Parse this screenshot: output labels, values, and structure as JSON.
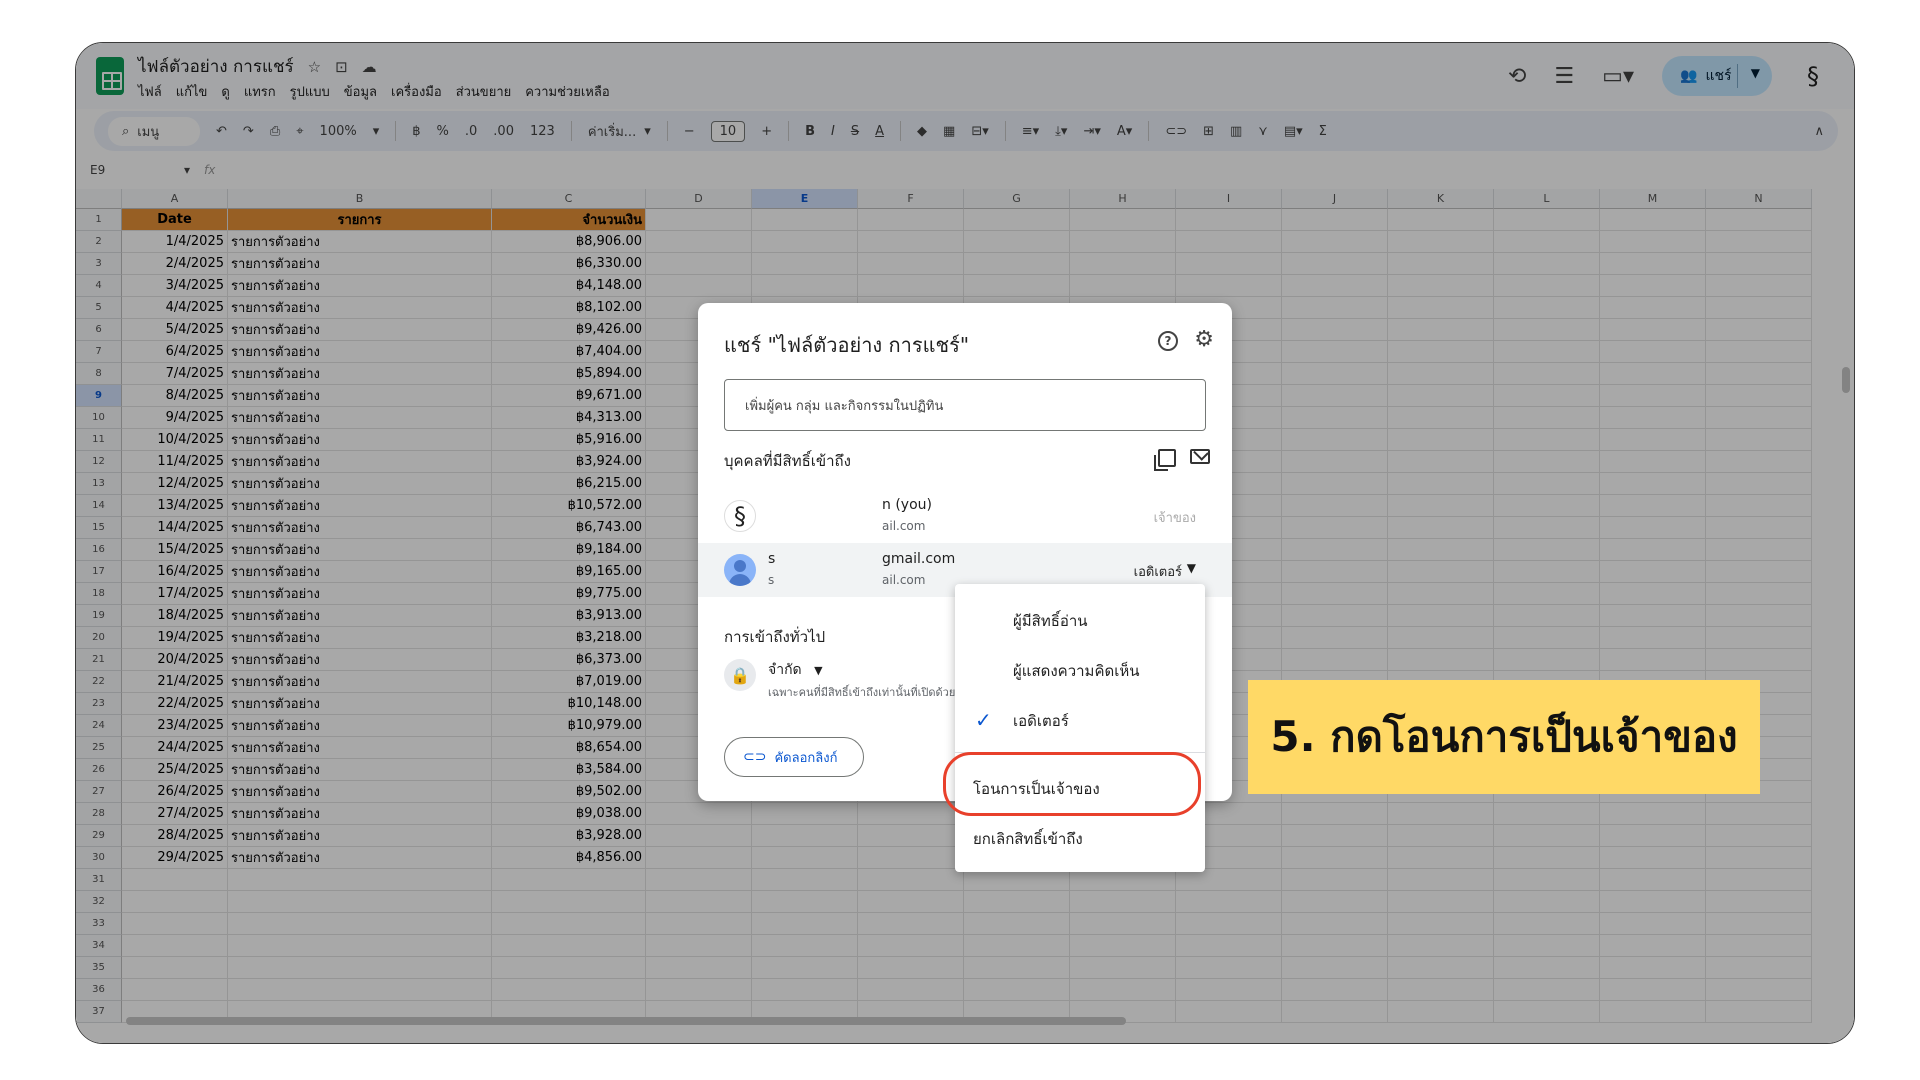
{
  "doc": {
    "title": "ไฟล์ตัวอย่าง การแชร์",
    "menus": [
      "ไฟล์",
      "แก้ไข",
      "ดู",
      "แทรก",
      "รูปแบบ",
      "ข้อมูล",
      "เครื่องมือ",
      "ส่วนขยาย",
      "ความช่วยเหลือ"
    ]
  },
  "topbar": {
    "share_label": "แชร์",
    "icons": [
      "history-icon",
      "comment-icon",
      "meet-icon",
      "share-people-icon",
      "account-avatar"
    ]
  },
  "toolbar": {
    "search_label": "เมนู",
    "zoom": "100%",
    "currency": "฿",
    "percent": "%",
    "dec_dec": ".0",
    "dec_inc": ".00",
    "number_format": "123",
    "font": "ค่าเริ่ม...",
    "font_size": "10",
    "minus": "−",
    "plus": "+",
    "bold": "B",
    "italic": "I",
    "sum": "Σ"
  },
  "formula_bar": {
    "cell_ref": "E9",
    "fx": "fx"
  },
  "grid": {
    "columns": [
      "A",
      "B",
      "C",
      "D",
      "E",
      "F",
      "G",
      "H",
      "I",
      "J",
      "K",
      "L",
      "M",
      "N"
    ],
    "selected_column": "E",
    "selected_row": "9",
    "header_row": [
      "Date",
      "รายการ",
      "จำนวนเงิน"
    ],
    "rows": [
      [
        "1/4/2025",
        "รายการตัวอย่าง",
        "฿8,906.00"
      ],
      [
        "2/4/2025",
        "รายการตัวอย่าง",
        "฿6,330.00"
      ],
      [
        "3/4/2025",
        "รายการตัวอย่าง",
        "฿4,148.00"
      ],
      [
        "4/4/2025",
        "รายการตัวอย่าง",
        "฿8,102.00"
      ],
      [
        "5/4/2025",
        "รายการตัวอย่าง",
        "฿9,426.00"
      ],
      [
        "6/4/2025",
        "รายการตัวอย่าง",
        "฿7,404.00"
      ],
      [
        "7/4/2025",
        "รายการตัวอย่าง",
        "฿5,894.00"
      ],
      [
        "8/4/2025",
        "รายการตัวอย่าง",
        "฿9,671.00"
      ],
      [
        "9/4/2025",
        "รายการตัวอย่าง",
        "฿4,313.00"
      ],
      [
        "10/4/2025",
        "รายการตัวอย่าง",
        "฿5,916.00"
      ],
      [
        "11/4/2025",
        "รายการตัวอย่าง",
        "฿3,924.00"
      ],
      [
        "12/4/2025",
        "รายการตัวอย่าง",
        "฿6,215.00"
      ],
      [
        "13/4/2025",
        "รายการตัวอย่าง",
        "฿10,572.00"
      ],
      [
        "14/4/2025",
        "รายการตัวอย่าง",
        "฿6,743.00"
      ],
      [
        "15/4/2025",
        "รายการตัวอย่าง",
        "฿9,184.00"
      ],
      [
        "16/4/2025",
        "รายการตัวอย่าง",
        "฿9,165.00"
      ],
      [
        "17/4/2025",
        "รายการตัวอย่าง",
        "฿9,775.00"
      ],
      [
        "18/4/2025",
        "รายการตัวอย่าง",
        "฿3,913.00"
      ],
      [
        "19/4/2025",
        "รายการตัวอย่าง",
        "฿3,218.00"
      ],
      [
        "20/4/2025",
        "รายการตัวอย่าง",
        "฿6,373.00"
      ],
      [
        "21/4/2025",
        "รายการตัวอย่าง",
        "฿7,019.00"
      ],
      [
        "22/4/2025",
        "รายการตัวอย่าง",
        "฿10,148.00"
      ],
      [
        "23/4/2025",
        "รายการตัวอย่าง",
        "฿10,979.00"
      ],
      [
        "24/4/2025",
        "รายการตัวอย่าง",
        "฿8,654.00"
      ],
      [
        "25/4/2025",
        "รายการตัวอย่าง",
        "฿3,584.00"
      ],
      [
        "26/4/2025",
        "รายการตัวอย่าง",
        "฿9,502.00"
      ],
      [
        "27/4/2025",
        "รายการตัวอย่าง",
        "฿9,038.00"
      ],
      [
        "28/4/2025",
        "รายการตัวอย่าง",
        "฿3,928.00"
      ],
      [
        "29/4/2025",
        "รายการตัวอย่าง",
        "฿4,856.00"
      ]
    ],
    "row_numbers": [
      "1",
      "2",
      "3",
      "4",
      "5",
      "6",
      "7",
      "8",
      "9",
      "10",
      "11",
      "12",
      "13",
      "14",
      "15",
      "16",
      "17",
      "18",
      "19",
      "20",
      "21",
      "22",
      "23",
      "24",
      "25",
      "26",
      "27",
      "28",
      "29",
      "30",
      "31",
      "32",
      "33",
      "34",
      "35",
      "36",
      "37"
    ],
    "header_color": "#e69138"
  },
  "dialog": {
    "title": "แชร์ \"ไฟล์ตัวอย่าง การแชร์\"",
    "help": "?",
    "add_placeholder": "เพิ่มผู้คน กลุ่ม และกิจกรรมในปฏิทิน",
    "people_heading": "บุคคลที่มีสิทธิ์เข้าถึง",
    "people": [
      {
        "name": "n (you)",
        "email": "ail.com",
        "role": "เจ้าของ"
      },
      {
        "name": "s",
        "name_tail": "gmail.com",
        "email_head": "s",
        "email": "ail.com",
        "role": "เอดิเตอร์"
      }
    ],
    "general_access_heading": "การเข้าถึงทั่วไป",
    "access_level": "จำกัด",
    "access_desc": "เฉพาะคนที่มีสิทธิ์เข้าถึงเท่านั้นที่เปิดด้วยลิงก์นี้ได้",
    "copy_link": "คัดลอกลิงก์"
  },
  "role_menu": {
    "items": [
      "ผู้มีสิทธิ์อ่าน",
      "ผู้แสดงความคิดเห็น",
      "เอดิเตอร์"
    ],
    "checked": "เอดิเตอร์",
    "transfer": "โอนการเป็นเจ้าของ",
    "remove": "ยกเลิกสิทธิ์เข้าถึง"
  },
  "annotation": {
    "text": "5. กดโอนการเป็นเจ้าของ",
    "color": "#ffd966",
    "ring_color": "#e8402b"
  }
}
